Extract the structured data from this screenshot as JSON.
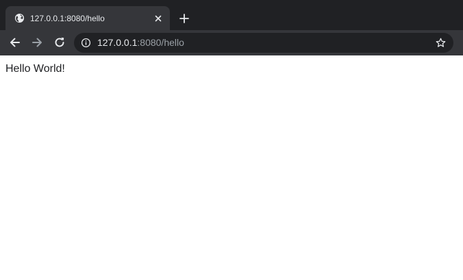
{
  "tab": {
    "title": "127.0.0.1:8080/hello",
    "favicon": "globe-icon"
  },
  "toolbar": {
    "url_host": "127.0.0.1",
    "url_rest": ":8080/hello"
  },
  "page": {
    "text": "Hello World!"
  },
  "colors": {
    "tab_strip": "#202124",
    "active_tab": "#35363a",
    "omnibox": "#202124",
    "text_light": "#e8eaed",
    "text_muted": "#9aa0a6"
  }
}
